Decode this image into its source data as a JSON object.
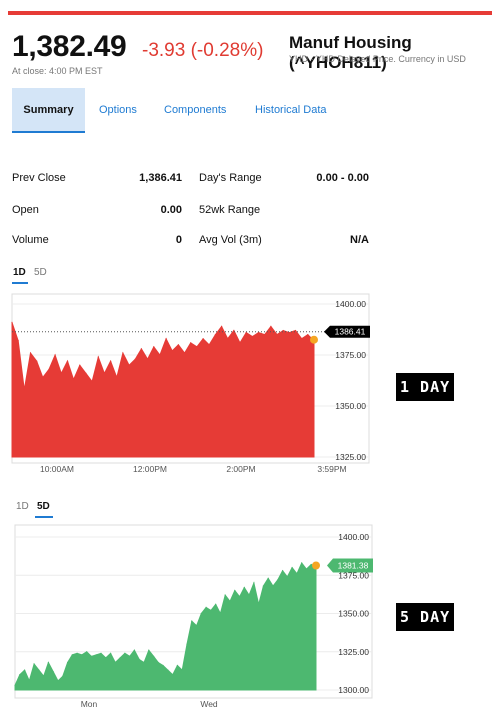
{
  "header": {
    "price": "1,382.49",
    "change": "-3.93 (-0.28%)",
    "close_time": "At close: 4:00 PM EST",
    "name": "Manuf Housing (^YHOH811)",
    "subname": "YHD - YHD Delayed Price. Currency in USD"
  },
  "tabs": [
    {
      "label": "Summary"
    },
    {
      "label": "Options"
    },
    {
      "label": "Components"
    },
    {
      "label": "Historical Data"
    }
  ],
  "stats": {
    "prev_close_label": "Prev Close",
    "prev_close": "1,386.41",
    "open_label": "Open",
    "open": "0.00",
    "volume_label": "Volume",
    "volume": "0",
    "days_range_label": "Day's Range",
    "days_range": "0.00 - 0.00",
    "wk52_label": "52wk Range",
    "wk52": "",
    "avg_vol_label": "Avg Vol (3m)",
    "avg_vol": "N/A"
  },
  "range_tabs_1": {
    "a": "1D",
    "b": "5D"
  },
  "range_tabs_2": {
    "a": "1D",
    "b": "5D"
  },
  "tags": {
    "one_day": "1 DAY",
    "five_day": "5 DAY"
  },
  "colors": {
    "red": "#e63b36",
    "green": "#4db870",
    "link": "#1f7bd2",
    "marker": "#f5a623"
  },
  "chart_data": [
    {
      "type": "area",
      "range": "1D",
      "x_ticks": [
        "10:00AM",
        "12:00PM",
        "2:00PM",
        "3:59PM"
      ],
      "y_ticks": [
        "1400.00",
        "1375.00",
        "1350.00",
        "1325.00"
      ],
      "ylim": [
        1325,
        1400
      ],
      "reference_line": 1386.41,
      "reference_label": "1386.41",
      "last_value": 1382.49,
      "values": [
        1391,
        1382,
        1358,
        1376,
        1372,
        1364,
        1368,
        1375,
        1366,
        1372,
        1363,
        1370,
        1366,
        1362,
        1374,
        1366,
        1372,
        1364,
        1376,
        1370,
        1373,
        1378,
        1373,
        1379,
        1375,
        1383,
        1377,
        1380,
        1376,
        1381,
        1379,
        1383,
        1380,
        1385,
        1389,
        1383,
        1387,
        1381,
        1386,
        1384,
        1386,
        1385,
        1389,
        1385,
        1387,
        1386,
        1387,
        1383,
        1385,
        1382
      ]
    },
    {
      "type": "area",
      "range": "5D",
      "x_ticks": [
        "Mon",
        "Wed"
      ],
      "y_ticks": [
        "1400.00",
        "1375.00",
        "1350.00",
        "1325.00",
        "1300.00"
      ],
      "ylim": [
        1300,
        1400
      ],
      "last_value": 1381.38,
      "last_label": "1381.38",
      "values": [
        1303,
        1310,
        1313,
        1306,
        1317,
        1313,
        1309,
        1318,
        1312,
        1306,
        1309,
        1318,
        1323,
        1324,
        1323,
        1325,
        1322,
        1323,
        1324,
        1321,
        1324,
        1318,
        1321,
        1324,
        1322,
        1326,
        1320,
        1318,
        1326,
        1322,
        1318,
        1316,
        1313,
        1310,
        1316,
        1313,
        1330,
        1345,
        1342,
        1350,
        1354,
        1352,
        1356,
        1350,
        1362,
        1358,
        1365,
        1361,
        1367,
        1362,
        1370,
        1356,
        1368,
        1373,
        1368,
        1372,
        1378,
        1374,
        1380,
        1376,
        1383,
        1379,
        1382,
        1381
      ]
    }
  ]
}
